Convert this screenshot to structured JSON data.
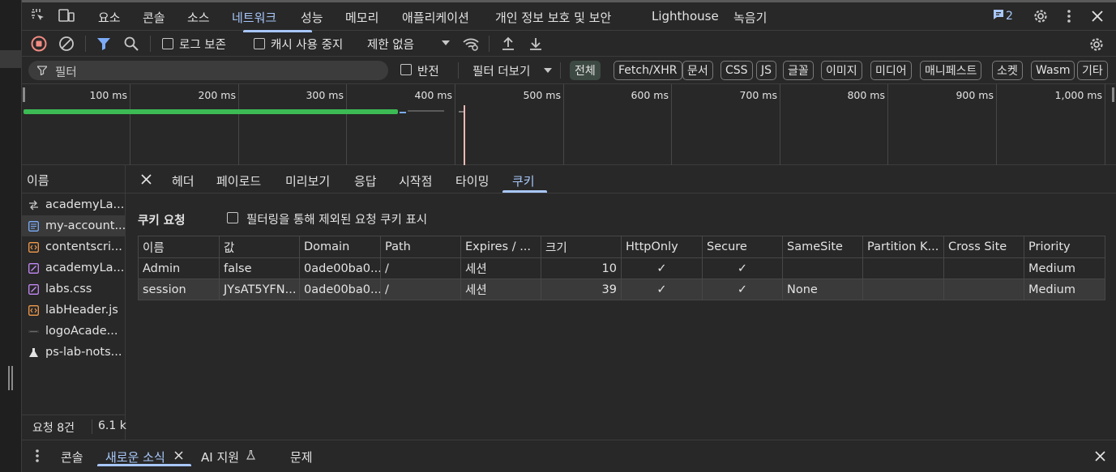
{
  "main_tabs": [
    {
      "label": "요소"
    },
    {
      "label": "콘솔"
    },
    {
      "label": "소스"
    },
    {
      "label": "네트워크"
    },
    {
      "label": "성능"
    },
    {
      "label": "메모리"
    },
    {
      "label": "애플리케이션"
    },
    {
      "label": "개인 정보 보호 및 보안"
    },
    {
      "label": "Lighthouse"
    },
    {
      "label": "녹음기"
    }
  ],
  "issues_count": "2",
  "toolbar": {
    "preserve_log": "로그 보존",
    "disable_cache": "캐시 사용 중지",
    "throttling": "제한 없음"
  },
  "filter": {
    "placeholder": "필터",
    "invert": "반전",
    "more_filters": "필터 더보기",
    "types": [
      "전체",
      "Fetch/XHR",
      "문서",
      "CSS",
      "JS",
      "글꼴",
      "이미지",
      "미디어",
      "매니페스트",
      "소켓",
      "Wasm",
      "기타"
    ]
  },
  "timeline": {
    "ticks": [
      "100 ms",
      "200 ms",
      "300 ms",
      "400 ms",
      "500 ms",
      "600 ms",
      "700 ms",
      "800 ms",
      "900 ms",
      "1,000 ms"
    ]
  },
  "requests": {
    "header": "이름",
    "items": [
      {
        "name": "academyLa...",
        "icon": "websocket-icon"
      },
      {
        "name": "my-account...",
        "icon": "document-icon"
      },
      {
        "name": "contentscri...",
        "icon": "script-icon"
      },
      {
        "name": "academyLa...",
        "icon": "stylesheet-icon"
      },
      {
        "name": "labs.css",
        "icon": "stylesheet-icon"
      },
      {
        "name": "labHeader.js",
        "icon": "script-icon"
      },
      {
        "name": "logoAcade...",
        "icon": "image-icon"
      },
      {
        "name": "ps-lab-nots...",
        "icon": "flask-icon"
      }
    ],
    "status_count": "요청 8건",
    "status_size": "6.1 k"
  },
  "detail_tabs": [
    {
      "label": "헤더"
    },
    {
      "label": "페이로드"
    },
    {
      "label": "미리보기"
    },
    {
      "label": "응답"
    },
    {
      "label": "시작점"
    },
    {
      "label": "타이밍"
    },
    {
      "label": "쿠키"
    }
  ],
  "cookies": {
    "section_title": "쿠키 요청",
    "show_filtered": "필터링을 통해 제외된 요청 쿠키 표시",
    "columns": [
      "이름",
      "값",
      "Domain",
      "Path",
      "Expires / ...",
      "크기",
      "HttpOnly",
      "Secure",
      "SameSite",
      "Partition K...",
      "Cross Site",
      "Priority"
    ],
    "rows": [
      [
        "Admin",
        "false",
        "0ade00ba0...",
        "/",
        "세션",
        "10",
        "✓",
        "✓",
        "",
        "",
        "",
        "Medium"
      ],
      [
        "session",
        "JYsAT5YFN...",
        "0ade00ba0...",
        "/",
        "세션",
        "39",
        "✓",
        "✓",
        "None",
        "",
        "",
        "Medium"
      ]
    ]
  },
  "drawer_tabs": [
    {
      "label": "콘솔"
    },
    {
      "label": "새로운 소식"
    },
    {
      "label": "AI 지원"
    },
    {
      "label": "문제"
    }
  ],
  "colors": {
    "accent": "#a8c7fa",
    "record_red": "#f28b82",
    "filter_blue": "#7cacf8",
    "timeline_green": "#3cba54"
  }
}
